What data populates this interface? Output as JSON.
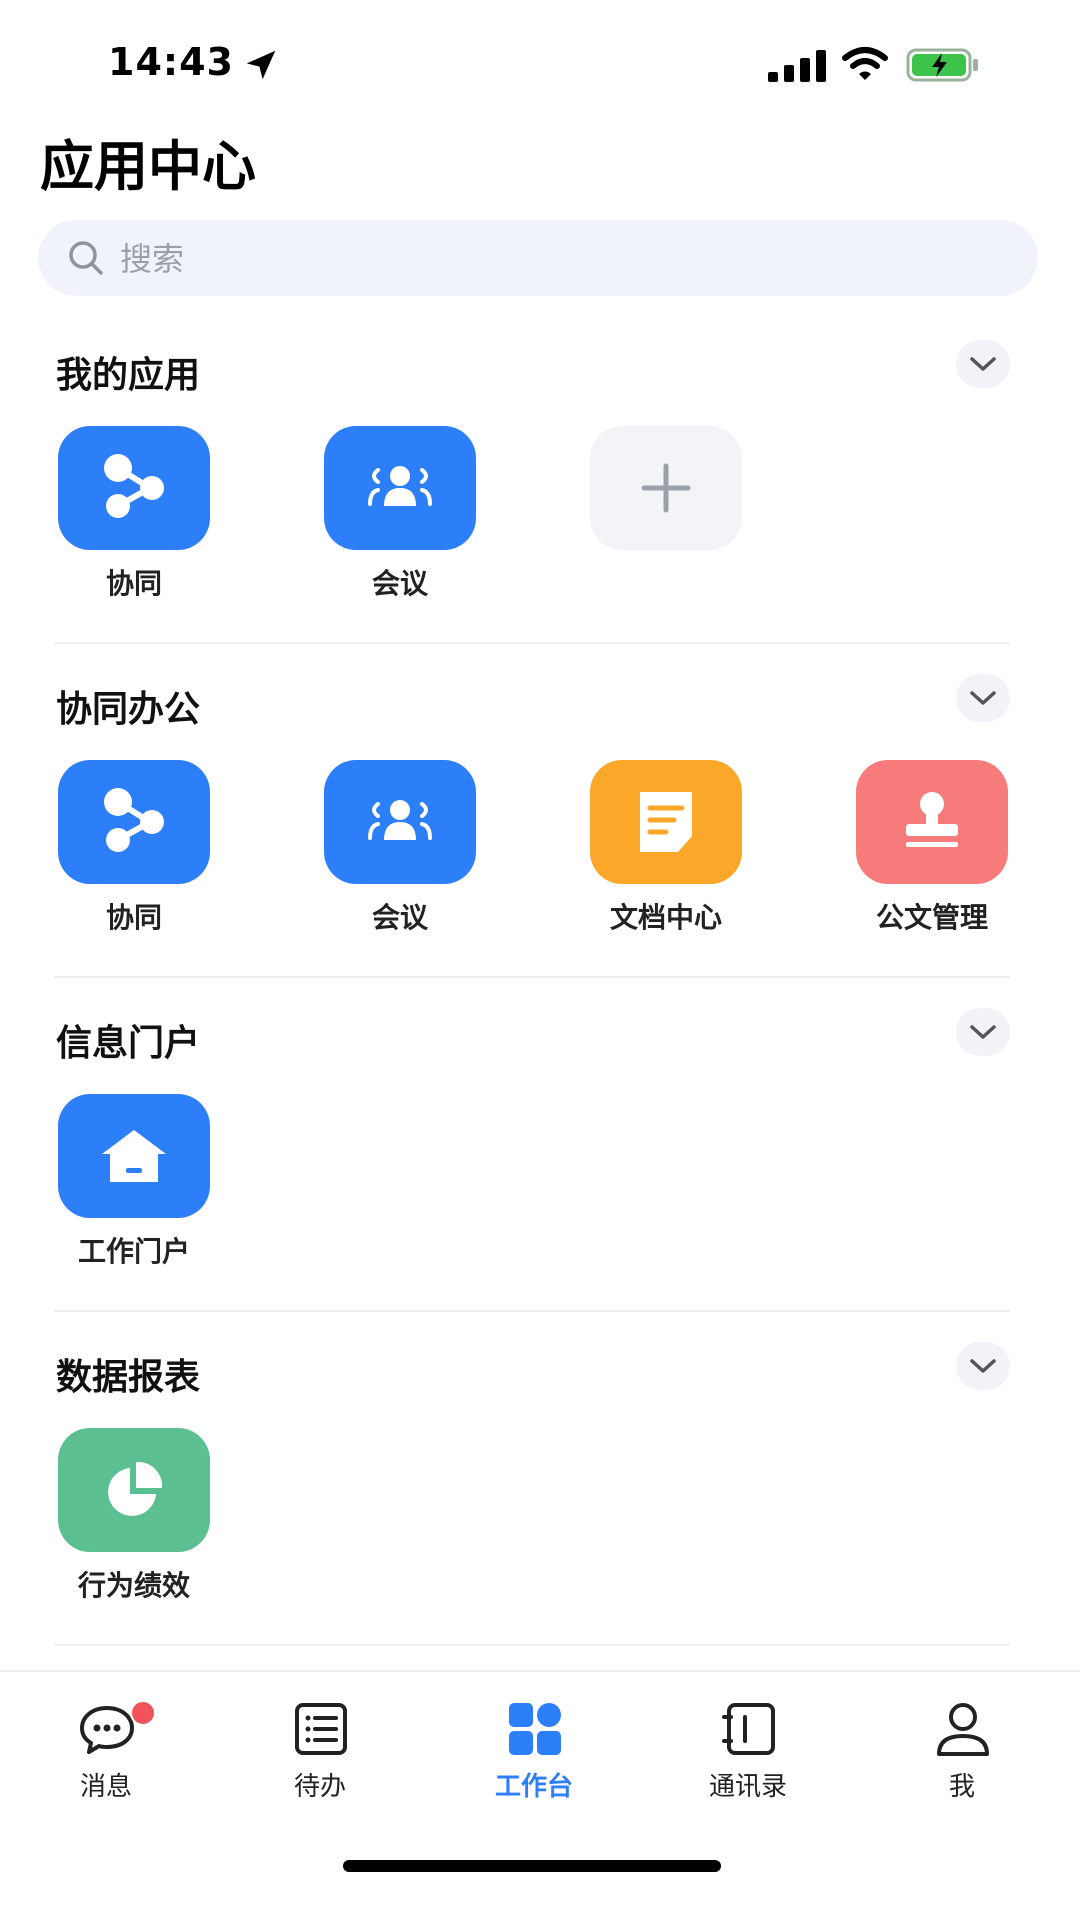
{
  "status_bar": {
    "time": "14:43"
  },
  "header": {
    "title": "应用中心"
  },
  "search": {
    "placeholder": "搜索"
  },
  "sections": [
    {
      "title": "我的应用",
      "apps": [
        {
          "label": "协同",
          "icon": "share-nodes-icon",
          "color": "#2d7ff9"
        },
        {
          "label": "会议",
          "icon": "group-icon",
          "color": "#2d7ff9"
        },
        {
          "label": "",
          "icon": "plus-icon",
          "color": "#f2f4f8"
        }
      ]
    },
    {
      "title": "协同办公",
      "apps": [
        {
          "label": "协同",
          "icon": "share-nodes-icon",
          "color": "#2d7ff9"
        },
        {
          "label": "会议",
          "icon": "group-icon",
          "color": "#2d7ff9"
        },
        {
          "label": "文档中心",
          "icon": "document-icon",
          "color": "#fba72a"
        },
        {
          "label": "公文管理",
          "icon": "stamp-icon",
          "color": "#f77b7b"
        }
      ]
    },
    {
      "title": "信息门户",
      "apps": [
        {
          "label": "工作门户",
          "icon": "house-icon",
          "color": "#2d7ff9"
        }
      ]
    },
    {
      "title": "数据报表",
      "apps": [
        {
          "label": "行为绩效",
          "icon": "pie-chart-icon",
          "color": "#5cbf92"
        }
      ]
    }
  ],
  "tab_bar": {
    "items": [
      {
        "label": "消息",
        "icon": "chat-bubble-icon",
        "badge": true
      },
      {
        "label": "待办",
        "icon": "checklist-icon"
      },
      {
        "label": "工作台",
        "icon": "grid-icon",
        "active": true
      },
      {
        "label": "通讯录",
        "icon": "address-book-icon"
      },
      {
        "label": "我",
        "icon": "person-icon"
      }
    ],
    "active_color": "#2d7ff9"
  }
}
